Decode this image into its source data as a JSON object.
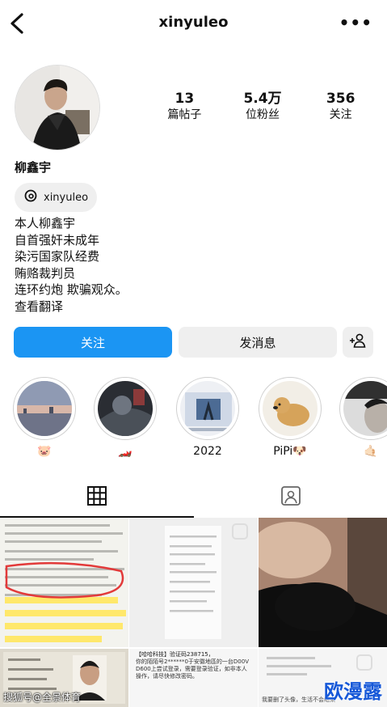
{
  "header": {
    "username": "xinyuleo",
    "back_icon": "chevron-left-icon",
    "more_icon": "more-horizontal-icon",
    "more_glyph": "•••"
  },
  "profile": {
    "display_name": "柳鑫宇",
    "threads_label": "xinyuleo",
    "stats": [
      {
        "value": "13",
        "label": "篇帖子"
      },
      {
        "value": "5.4万",
        "label": "位粉丝"
      },
      {
        "value": "356",
        "label": "关注"
      }
    ],
    "bio": [
      "本人柳鑫宇",
      "自首强奸未成年",
      "染污国家队经费",
      "贿赂裁判员",
      "连环约炮 欺骗观众。",
      "查看翻译"
    ]
  },
  "actions": {
    "follow": "关注",
    "message": "发消息",
    "add_user_icon": "add-user-icon"
  },
  "highlights": [
    {
      "caption": "🐷"
    },
    {
      "caption": "🏎️"
    },
    {
      "caption": "2022"
    },
    {
      "caption": "PiPi🐶"
    },
    {
      "caption": "🤙🏻"
    }
  ],
  "tabs": {
    "grid_icon": "grid-icon",
    "tagged_icon": "tagged-icon"
  },
  "grid": {
    "post4_title": "【哈哈科技】验证码238715，",
    "post4_body": "你的陌陌号2******0于安徽地區的一台D00V D600上尝试登录，需要登录验证，如非本人操作，请尽快修改密码。",
    "post5_caption": "我要删了头像，生活不会结束"
  },
  "watermarks": {
    "left": "搜狐号@全景体育",
    "right": "欧漫露"
  },
  "colors": {
    "accent": "#1b95f3",
    "secondary_button": "#efefef"
  }
}
